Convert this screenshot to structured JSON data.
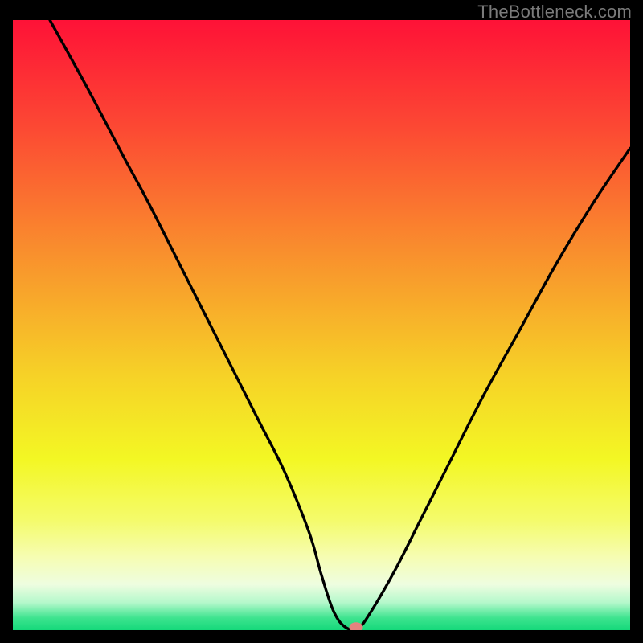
{
  "watermark": "TheBottleneck.com",
  "chart_data": {
    "type": "line",
    "title": "",
    "xlabel": "",
    "ylabel": "",
    "xlim": [
      0,
      100
    ],
    "ylim": [
      0,
      100
    ],
    "grid": false,
    "legend": false,
    "series": [
      {
        "name": "curve",
        "x": [
          6,
          12,
          18,
          22,
          28,
          34,
          40,
          44,
          48,
          50,
          52,
          54,
          56,
          58,
          62,
          66,
          70,
          76,
          82,
          88,
          94,
          100
        ],
        "values": [
          100,
          89,
          77.5,
          70,
          58,
          46,
          34,
          26,
          16,
          9,
          3,
          0.4,
          0.4,
          3,
          10,
          18,
          26,
          38,
          49,
          60,
          70,
          79
        ]
      }
    ],
    "marker": {
      "x": 55.6,
      "y": 0.5,
      "color": "#e4827f"
    },
    "background_gradient_stops": [
      {
        "offset": 0.0,
        "color": "#fe1237"
      },
      {
        "offset": 0.18,
        "color": "#fc4a33"
      },
      {
        "offset": 0.38,
        "color": "#f98f2d"
      },
      {
        "offset": 0.58,
        "color": "#f6d127"
      },
      {
        "offset": 0.72,
        "color": "#f3f724"
      },
      {
        "offset": 0.82,
        "color": "#f4fb6b"
      },
      {
        "offset": 0.88,
        "color": "#f6fdb2"
      },
      {
        "offset": 0.925,
        "color": "#eefde0"
      },
      {
        "offset": 0.955,
        "color": "#b4f8cb"
      },
      {
        "offset": 0.98,
        "color": "#3ee48f"
      },
      {
        "offset": 1.0,
        "color": "#14d87a"
      }
    ]
  }
}
